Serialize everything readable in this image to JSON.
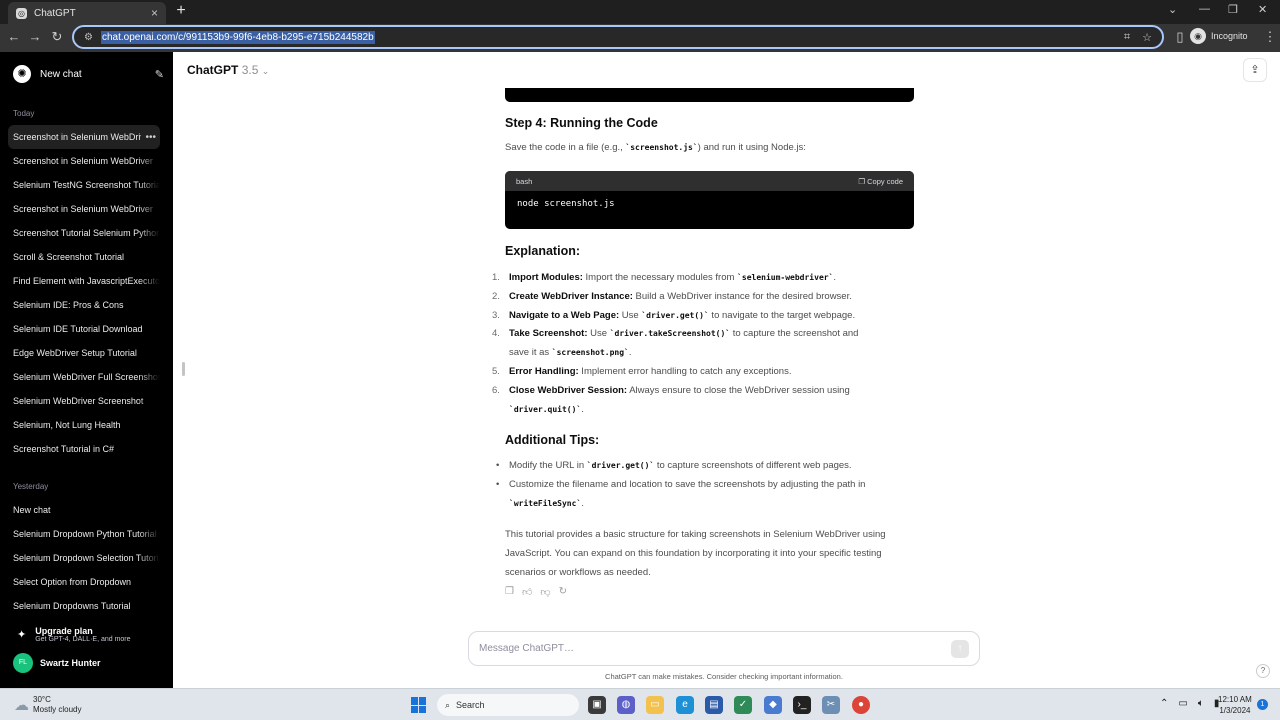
{
  "browser": {
    "tab_title": "ChatGPT",
    "url": "chat.openai.com/c/991153b9-99f6-4eb8-b295-e715b244582b",
    "incognito_label": "Incognito"
  },
  "sidebar": {
    "new_chat": "New chat",
    "groups": {
      "today": "Today",
      "yesterday": "Yesterday"
    },
    "today_items": [
      {
        "label": "Screenshot in Selenium WebDriver"
      },
      {
        "label": "Screenshot in Selenium WebDriver"
      },
      {
        "label": "Selenium TestNG Screenshot Tutorial"
      },
      {
        "label": "Screenshot in Selenium WebDriver"
      },
      {
        "label": "Screenshot Tutorial Selenium Python"
      },
      {
        "label": "Scroll & Screenshot Tutorial"
      },
      {
        "label": "Find Element with JavascriptExecutor"
      },
      {
        "label": "Selenium IDE: Pros & Cons"
      },
      {
        "label": "Selenium IDE Tutorial Download"
      },
      {
        "label": "Edge WebDriver Setup Tutorial"
      },
      {
        "label": "Selenium WebDriver Full Screenshot"
      },
      {
        "label": "Selenium WebDriver Screenshot"
      },
      {
        "label": "Selenium, Not Lung Health"
      },
      {
        "label": "Screenshot Tutorial in C#"
      }
    ],
    "yesterday_items": [
      {
        "label": "New chat"
      },
      {
        "label": "Selenium Dropdown Python Tutorial"
      },
      {
        "label": "Selenium Dropdown Selection Tutorial"
      },
      {
        "label": "Select Option from Dropdown"
      },
      {
        "label": "Selenium Dropdowns Tutorial"
      }
    ],
    "upgrade": {
      "title": "Upgrade plan",
      "subtitle": "Get GPT-4, DALL·E, and more"
    },
    "user": {
      "initials": "FL",
      "name": "Swartz Hunter"
    }
  },
  "header": {
    "model": "ChatGPT",
    "version": "3.5"
  },
  "message": {
    "step4_heading": "Step 4: Running the Code",
    "step4_text_pre": "Save the code in a file (e.g., ",
    "step4_code": "`screenshot.js`",
    "step4_text_post": ") and run it using Node.js:",
    "codeblock": {
      "lang": "bash",
      "copy": "Copy code",
      "code": "node screenshot.js"
    },
    "explanation_heading": "Explanation:",
    "explanation": [
      {
        "num": "1.",
        "key": "Import Modules:",
        "pre": " Import the necessary modules from ",
        "code": "`selenium-webdriver`",
        "post": "."
      },
      {
        "num": "2.",
        "key": "Create WebDriver Instance:",
        "pre": " Build a WebDriver instance for the desired browser.",
        "code": "",
        "post": ""
      },
      {
        "num": "3.",
        "key": "Navigate to a Web Page:",
        "pre": " Use ",
        "code": "`driver.get()`",
        "post": " to navigate to the target webpage."
      },
      {
        "num": "4.",
        "key": "Take Screenshot:",
        "pre": " Use ",
        "code": "`driver.takeScreenshot()`",
        "post": " to capture the screenshot and",
        "pre2": "save it as ",
        "code2": "`screenshot.png`",
        "post2": "."
      },
      {
        "num": "5.",
        "key": "Error Handling:",
        "pre": " Implement error handling to catch any exceptions.",
        "code": "",
        "post": ""
      },
      {
        "num": "6.",
        "key": "Close WebDriver Session:",
        "pre": " Always ensure to close the WebDriver session using",
        "code": "",
        "post": "",
        "pre2": "",
        "code2": "`driver.quit()`",
        "post2": "."
      }
    ],
    "tips_heading": "Additional Tips:",
    "tips": [
      {
        "pre": "Modify the URL in ",
        "code": "`driver.get()`",
        "post": " to capture screenshots of different web pages."
      },
      {
        "pre": "Customize the filename and location to save the screenshots by adjusting the path in",
        "code": "",
        "post": "",
        "code2": "`writeFileSync`",
        "post2": "."
      }
    ],
    "summary": "This tutorial provides a basic structure for taking screenshots in Selenium WebDriver using JavaScript. You can expand on this foundation by incorporating it into your specific testing scenarios or workflows as needed."
  },
  "composer": {
    "placeholder": "Message ChatGPT…",
    "disclaimer": "ChatGPT can make mistakes. Consider checking important information."
  },
  "taskbar": {
    "temp": "30°C",
    "weather": "Mostly cloudy",
    "search": "Search",
    "time": "12:10 AM",
    "date": "1/3/2024",
    "notif_count": "1"
  }
}
